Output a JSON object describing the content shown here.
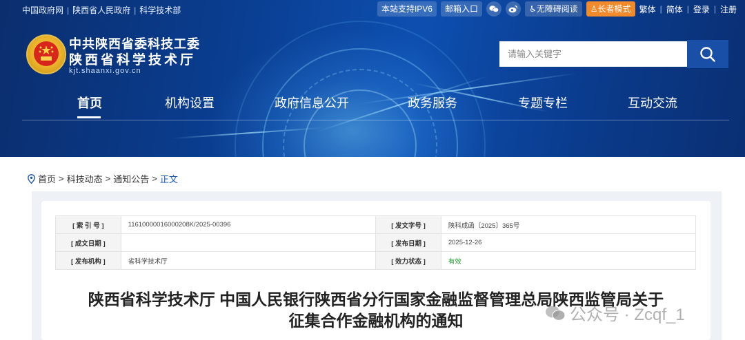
{
  "topbar": {
    "left_links": [
      "中国政府网",
      "陕西省人民政府",
      "科学技术部"
    ],
    "ipv6": "本站支持IPV6",
    "mailbox": "邮箱入口",
    "accessible": "无障碍阅读",
    "elder_mode": "长者模式",
    "traditional": "繁体",
    "simplified": "简体",
    "login": "登录",
    "register": "注册"
  },
  "logo": {
    "line1": "中共陕西省委科技工委",
    "line2": "陕西省科学技术厅",
    "domain": "kjt.shaanxi.gov.cn"
  },
  "search": {
    "placeholder": "请输入关键字"
  },
  "nav": {
    "items": [
      "首页",
      "机构设置",
      "政府信息公开",
      "政务服务",
      "专题专栏",
      "互动交流"
    ],
    "active": "首页"
  },
  "breadcrumb": [
    "首页",
    "科技动态",
    "通知公告",
    "正文"
  ],
  "meta": {
    "index_label": "[ 索 引 号 ]",
    "index_value": "11610000016000208K/2025-00396",
    "docno_label": "[ 发文字号 ]",
    "docno_value": "陕科成函〔2025〕365号",
    "created_label": "[ 成文日期 ]",
    "created_value": "",
    "published_label": "[ 发布日期 ]",
    "published_value": "2025-12-26",
    "org_label": "[ 发布机构 ]",
    "org_value": "省科学技术厅",
    "status_label": "[ 效力状态 ]",
    "status_value": "有效"
  },
  "document": {
    "title_line1": "陕西省科学技术厅 中国人民银行陕西省分行国家金融监督管理总局陕西监管局关于",
    "title_line2": "征集合作金融机构的通知"
  },
  "watermark": {
    "text": "公众号 · Zcqf_1"
  },
  "colors": {
    "header_blue": "#0a3d8f",
    "elder_orange": "#f08a2a",
    "valid_green": "#1d9a2d",
    "crumb_blue": "#1a55b0"
  }
}
